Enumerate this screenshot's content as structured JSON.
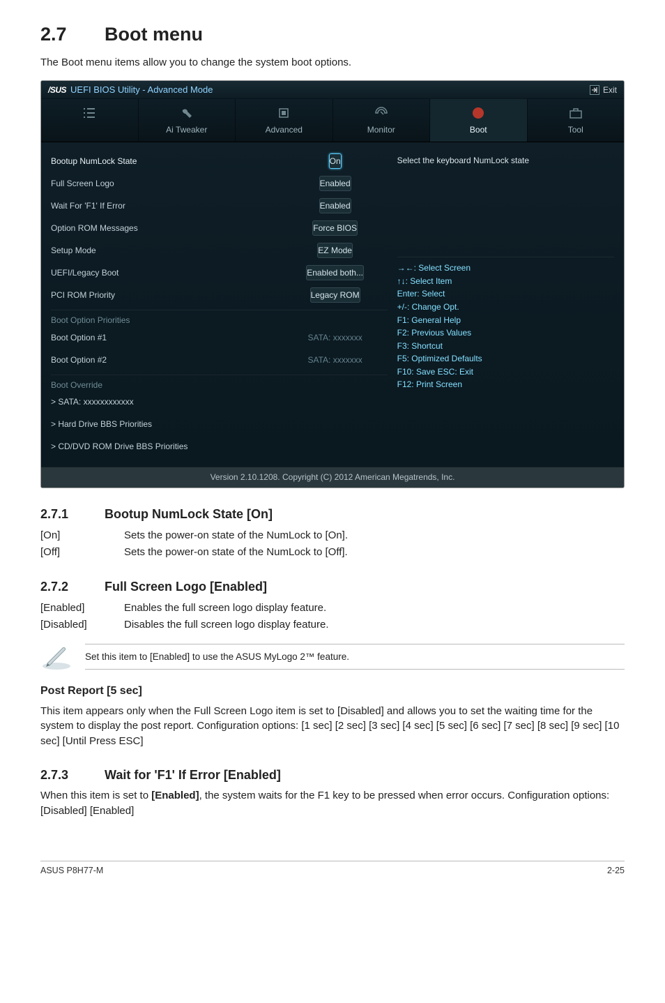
{
  "page": {
    "heading_num": "2.7",
    "heading": "Boot menu",
    "lead": "The Boot menu items allow you to change the system boot options."
  },
  "bios": {
    "logo_brand": "/SUS",
    "logo_text": "UEFI BIOS Utility - Advanced Mode",
    "exit": "Exit",
    "tabs": {
      "main": "",
      "tweaker": "Ai Tweaker",
      "advanced": "Advanced",
      "monitor": "Monitor",
      "boot": "Boot",
      "tool": "Tool"
    },
    "help_text": "Select the keyboard NumLock state",
    "rows": {
      "numlock": {
        "label": "Bootup NumLock State",
        "value": "On"
      },
      "fslogo": {
        "label": "Full Screen Logo",
        "value": "Enabled"
      },
      "waitf1": {
        "label": "Wait For 'F1' If Error",
        "value": "Enabled"
      },
      "optrom": {
        "label": "Option ROM Messages",
        "value": "Force BIOS"
      },
      "setup": {
        "label": "Setup Mode",
        "value": "EZ Mode"
      },
      "uefileg": {
        "label": "UEFI/Legacy Boot",
        "value": "Enabled both..."
      },
      "pcirom": {
        "label": "PCI ROM Priority",
        "value": "Legacy ROM"
      }
    },
    "boot_priorities_header": "Boot Option Priorities",
    "boot_opts": {
      "o1": {
        "label": "Boot Option #1",
        "value": "SATA: xxxxxxx"
      },
      "o2": {
        "label": "Boot Option #2",
        "value": "SATA: xxxxxxx"
      }
    },
    "override_header": "Boot Override",
    "override_items": {
      "sata": "> SATA: xxxxxxxxxxxx",
      "hdd": "> Hard Drive BBS Priorities",
      "cd": "> CD/DVD ROM Drive BBS Priorities"
    },
    "keys": {
      "k1": "→←: Select Screen",
      "k2": "↑↓: Select Item",
      "k3": "Enter: Select",
      "k4": "+/-: Change Opt.",
      "k5": "F1: General Help",
      "k6": "F2: Previous Values",
      "k7": "F3: Shortcut",
      "k8": "F5: Optimized Defaults",
      "k9": "F10: Save   ESC: Exit",
      "k10": "F12: Print Screen"
    },
    "footer": "Version 2.10.1208.  Copyright (C) 2012 American Megatrends, Inc."
  },
  "sect1": {
    "num": "2.7.1",
    "title": "Bootup NumLock State [On]",
    "on_k": "[On]",
    "on_v": "Sets the power-on state of the NumLock to [On].",
    "off_k": "[Off]",
    "off_v": "Sets the power-on state of the NumLock to [Off]."
  },
  "sect2": {
    "num": "2.7.2",
    "title": "Full Screen Logo [Enabled]",
    "en_k": "[Enabled]",
    "en_v": "Enables the full screen logo display feature.",
    "dis_k": "[Disabled]",
    "dis_v": "Disables the full screen logo display feature.",
    "note": "Set this item to [Enabled] to use the ASUS MyLogo 2™ feature."
  },
  "post": {
    "title": "Post Report [5 sec]",
    "body": "This item appears only when the Full Screen Logo item is set to [Disabled] and allows you to set the waiting time for the system to display the post report. Configuration options: [1 sec] [2 sec] [3 sec] [4 sec] [5 sec] [6 sec] [7 sec] [8 sec] [9 sec] [10 sec] [Until Press ESC]"
  },
  "sect3": {
    "num": "2.7.3",
    "title": "Wait for 'F1' If Error [Enabled]",
    "body_a": "When this item is set to ",
    "body_b": "[Enabled]",
    "body_c": ", the system waits for the F1 key to be pressed when error occurs. Configuration options: [Disabled] [Enabled]"
  },
  "pagefoot": {
    "left": "ASUS P8H77-M",
    "right": "2-25"
  }
}
